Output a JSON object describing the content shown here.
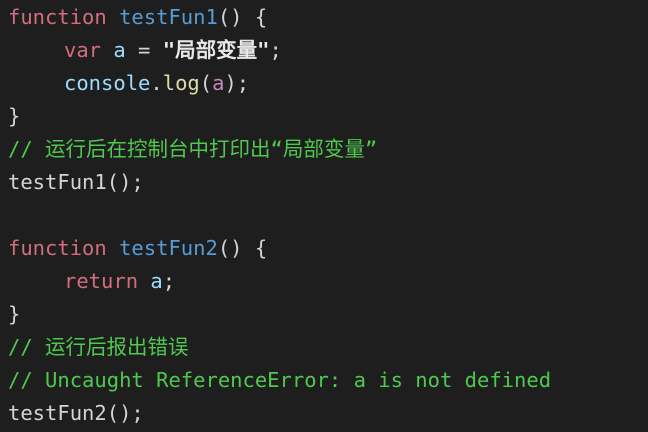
{
  "code": {
    "line1": {
      "kw": "function",
      "fn": "testFun1",
      "rest": "() {"
    },
    "line2": {
      "kw": "var",
      "id": "a",
      "op": " = ",
      "str": "\"局部变量\"",
      "end": ";"
    },
    "line3": {
      "obj": "console",
      "dot": ".",
      "method": "log",
      "open": "(",
      "arg": "a",
      "close": ");"
    },
    "line4": {
      "text": "}"
    },
    "line5": {
      "comment": "// 运行后在控制台中打印出“局部变量”"
    },
    "line6": {
      "text": "testFun1();"
    },
    "line7": {
      "text": ""
    },
    "line8": {
      "kw": "function",
      "fn": "testFun2",
      "rest": "() {"
    },
    "line9": {
      "kw": "return",
      "id": "a",
      "end": ";"
    },
    "line10": {
      "text": "}"
    },
    "line11": {
      "comment": "// 运行后报出错误"
    },
    "line12": {
      "comment": "// Uncaught ReferenceError: a is not defined"
    },
    "line13": {
      "text": "testFun2();"
    }
  }
}
